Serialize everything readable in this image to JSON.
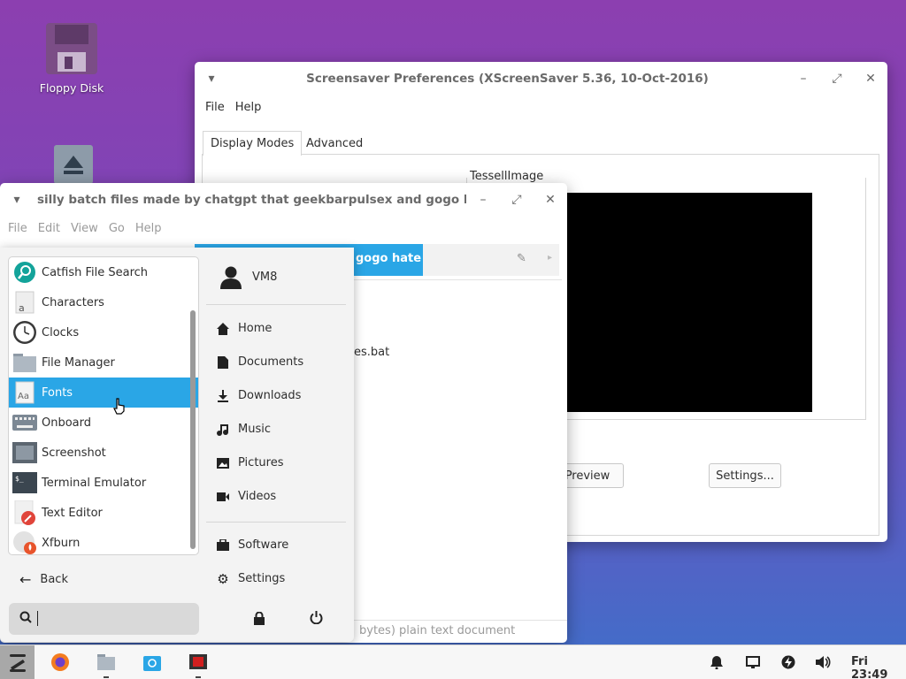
{
  "desktop": {
    "icons": [
      {
        "label": "Floppy Disk",
        "icon": "floppy-disk-icon"
      },
      {
        "label": "",
        "icon": "eject-icon"
      }
    ]
  },
  "screensaver_window": {
    "title": "Screensaver Preferences  (XScreenSaver 5.36, 10-Oct-2016)",
    "menu": [
      "File",
      "Help"
    ],
    "tabs": [
      "Display Modes",
      "Advanced"
    ],
    "preview_label": "TessellImage",
    "buttons": {
      "preview": "Preview",
      "settings": "Settings..."
    }
  },
  "file_manager": {
    "title": "silly batch files made by chatgpt that geekbarpulsex and gogo hate - File M",
    "menu": [
      "File",
      "Edit",
      "View",
      "Go",
      "Help"
    ],
    "path_button": "gogo hate",
    "file_partial": "es.bat",
    "status_partial": "bytes) plain text document"
  },
  "whisker_menu": {
    "username": "VM8",
    "apps": [
      {
        "label": "Catfish File Search",
        "icon": "catfish-search-icon"
      },
      {
        "label": "Characters",
        "icon": "characters-icon"
      },
      {
        "label": "Clocks",
        "icon": "clock-icon"
      },
      {
        "label": "File Manager",
        "icon": "folder-icon"
      },
      {
        "label": "Fonts",
        "icon": "fonts-icon",
        "selected": true
      },
      {
        "label": "Onboard",
        "icon": "keyboard-icon"
      },
      {
        "label": "Screenshot",
        "icon": "screenshot-icon"
      },
      {
        "label": "Terminal Emulator",
        "icon": "terminal-icon"
      },
      {
        "label": "Text Editor",
        "icon": "text-editor-icon"
      },
      {
        "label": "Xfburn",
        "icon": "xfburn-icon"
      }
    ],
    "places": [
      {
        "label": "Home",
        "icon": "home-icon"
      },
      {
        "label": "Documents",
        "icon": "document-icon"
      },
      {
        "label": "Downloads",
        "icon": "download-icon"
      },
      {
        "label": "Music",
        "icon": "music-icon"
      },
      {
        "label": "Pictures",
        "icon": "picture-icon"
      },
      {
        "label": "Videos",
        "icon": "video-icon"
      }
    ],
    "software": "Software",
    "settings": "Settings",
    "back": "Back",
    "search_value": ""
  },
  "taskbar": {
    "clock": "Fri 23:49",
    "accent": "#2aa6e6"
  }
}
